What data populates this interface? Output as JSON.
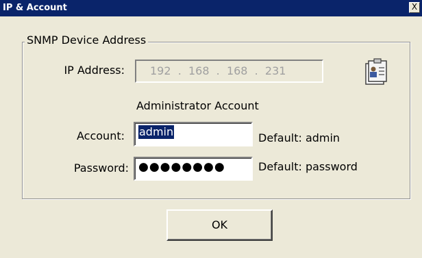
{
  "window": {
    "title": "IP & Account",
    "close_label": "X"
  },
  "group": {
    "legend": "SNMP Device Address"
  },
  "ip": {
    "label": "IP Address:",
    "value": "192  .  168  .  168  .  231"
  },
  "admin": {
    "heading": "Administrator Account"
  },
  "account": {
    "label": "Account:",
    "value": "admin",
    "default_note": "Default: admin"
  },
  "password": {
    "label": "Password:",
    "masked": "●●●●●●●●",
    "default_note": "Default: password"
  },
  "buttons": {
    "ok_label": "OK"
  },
  "icons": {
    "badge": "id-badge-icon"
  },
  "colors": {
    "titlebar": "#0a246a",
    "dialog": "#ece9d8",
    "selection": "#0a246a"
  }
}
